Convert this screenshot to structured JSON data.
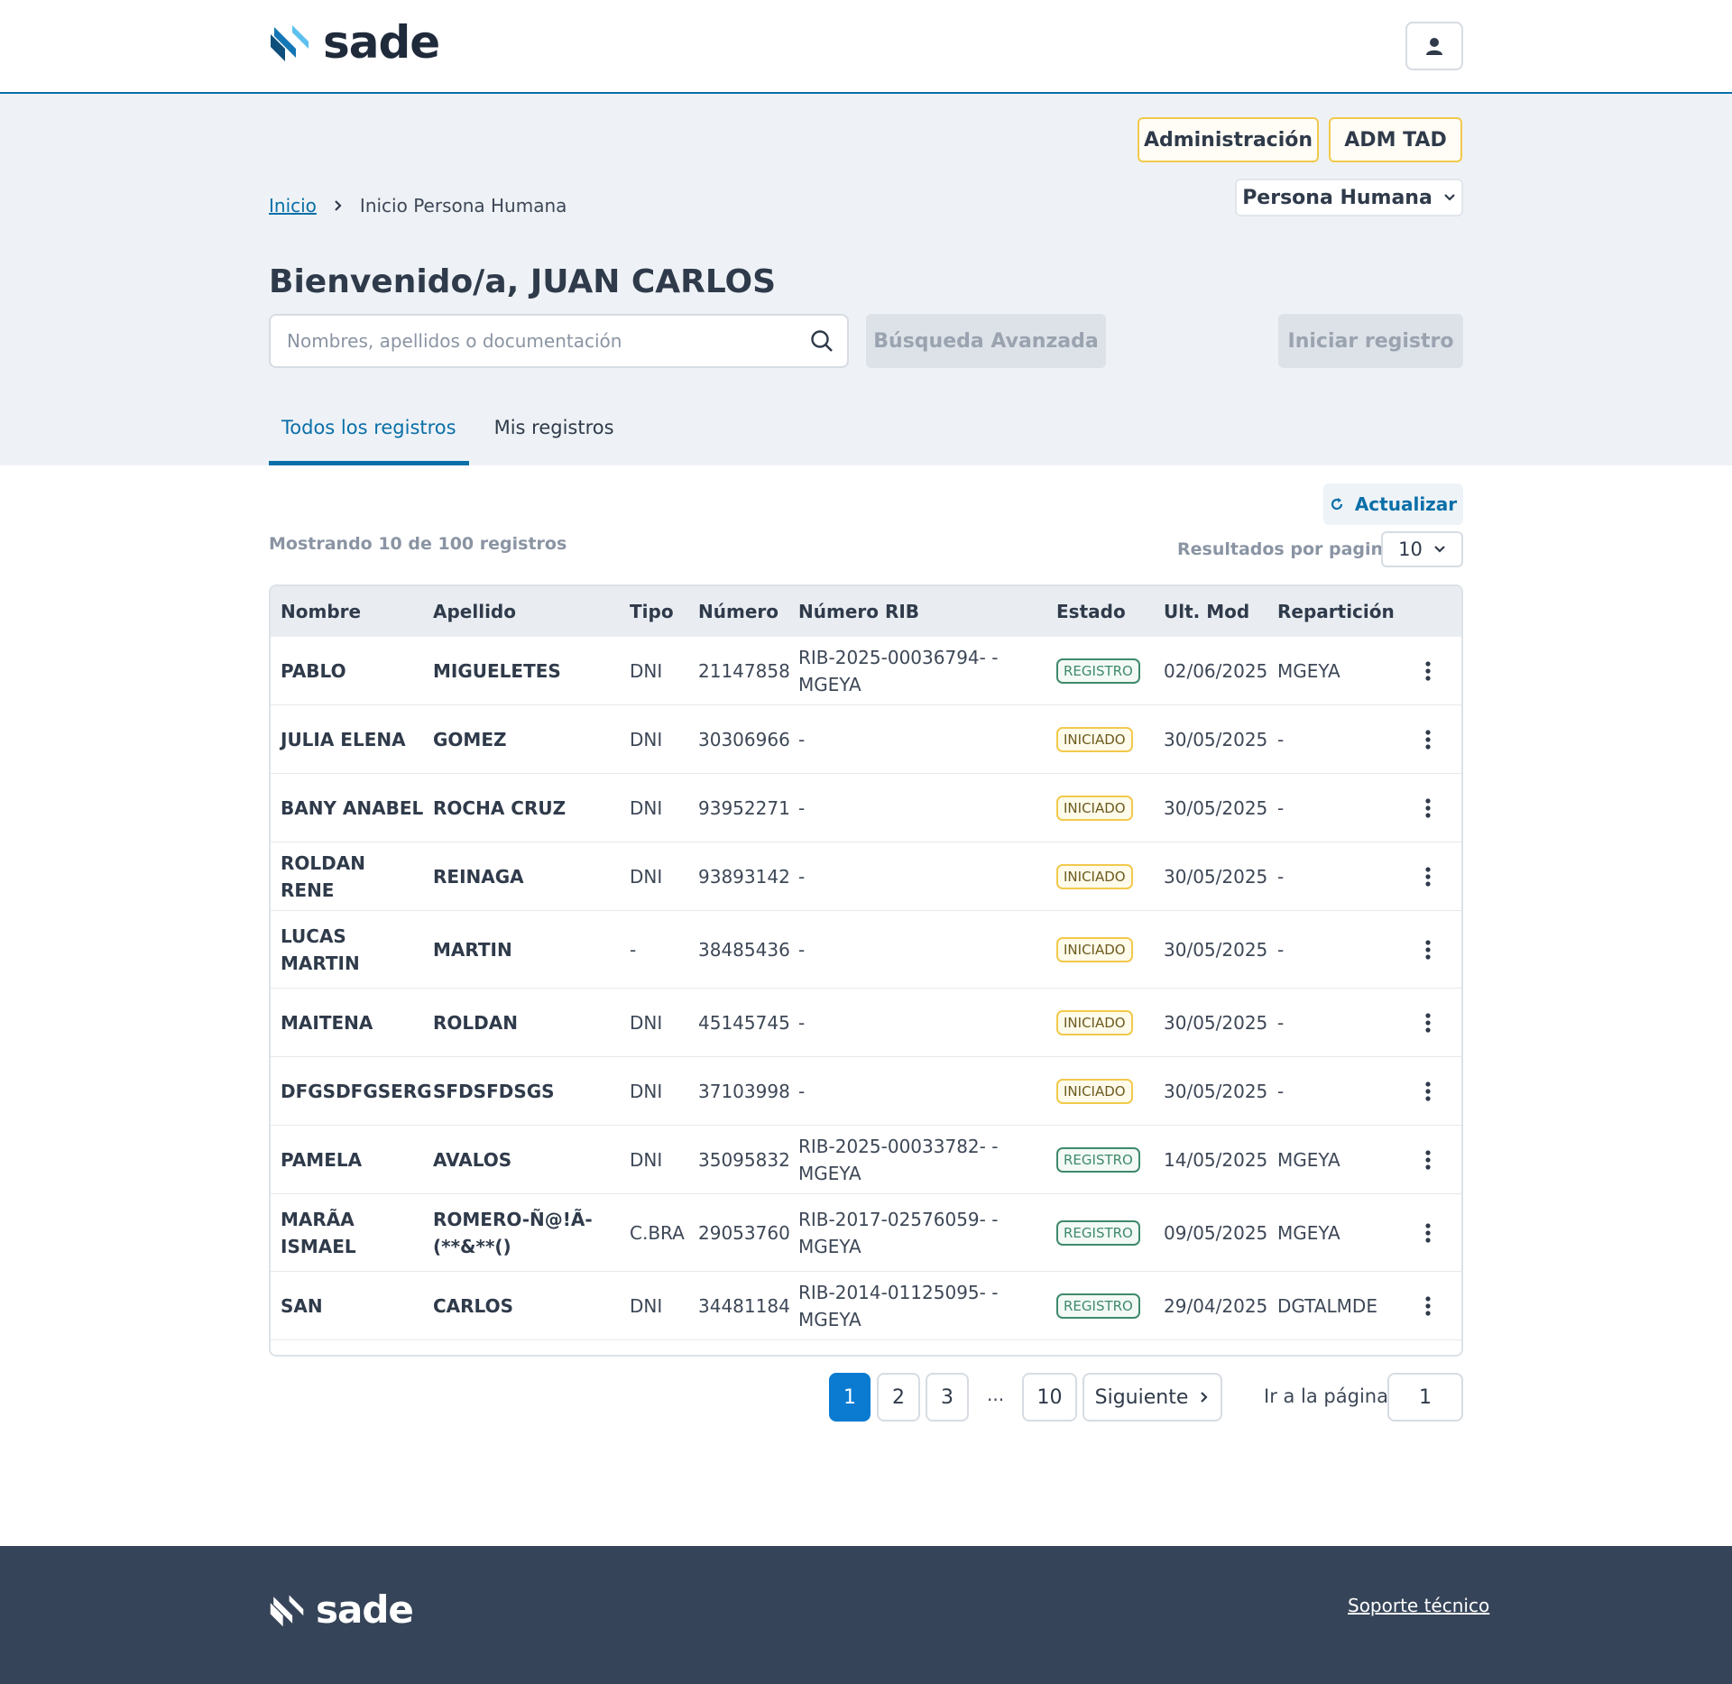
{
  "header": {
    "logo_text": "sade",
    "user_icon": "user-icon"
  },
  "hero": {
    "admin_button": "Administración",
    "admtad_button": "ADM TAD",
    "persona_select": "Persona Humana",
    "breadcrumb": {
      "home": "Inicio",
      "current": "Inicio Persona Humana"
    },
    "welcome": "Bienvenido/a, JUAN CARLOS",
    "search_placeholder": "Nombres, apellidos o documentación",
    "advanced_search": "Búsqueda Avanzada",
    "start_registration": "Iniciar registro",
    "tabs": [
      {
        "label": "Todos los registros",
        "active": true
      },
      {
        "label": "Mis registros",
        "active": false
      }
    ]
  },
  "toolbar": {
    "refresh": "Actualizar",
    "count_text": "Mostrando 10 de 100 registros",
    "per_page_label": "Resultados por pagina",
    "per_page_value": "10"
  },
  "table": {
    "columns": [
      "Nombre",
      "Apellido",
      "Tipo",
      "Número",
      "Número RIB",
      "Estado",
      "Ult. Mod",
      "Repartición"
    ],
    "rows": [
      {
        "nombre": "PABLO",
        "apellido": "MIGUELETES",
        "tipo": "DNI",
        "numero": "21147858",
        "rib": "RIB-2025-00036794- -MGEYA",
        "estado": "REGISTRO",
        "mod": "02/06/2025",
        "reparticion": "MGEYA"
      },
      {
        "nombre": "JULIA ELENA",
        "apellido": "GOMEZ",
        "tipo": "DNI",
        "numero": "30306966",
        "rib": "-",
        "estado": "INICIADO",
        "mod": "30/05/2025",
        "reparticion": "-"
      },
      {
        "nombre": "BANY ANABEL",
        "apellido": "ROCHA CRUZ",
        "tipo": "DNI",
        "numero": "93952271",
        "rib": "-",
        "estado": "INICIADO",
        "mod": "30/05/2025",
        "reparticion": "-"
      },
      {
        "nombre": "ROLDAN RENE",
        "apellido": "REINAGA",
        "tipo": "DNI",
        "numero": "93893142",
        "rib": "-",
        "estado": "INICIADO",
        "mod": "30/05/2025",
        "reparticion": "-"
      },
      {
        "nombre": "LUCAS MARTIN",
        "apellido": "MARTIN",
        "tipo": "-",
        "numero": "38485436",
        "rib": "-",
        "estado": "INICIADO",
        "mod": "30/05/2025",
        "reparticion": "-"
      },
      {
        "nombre": "MAITENA",
        "apellido": "ROLDAN",
        "tipo": "DNI",
        "numero": "45145745",
        "rib": "-",
        "estado": "INICIADO",
        "mod": "30/05/2025",
        "reparticion": "-"
      },
      {
        "nombre": "DFGSDFGSERG",
        "apellido": "SFDSFDSGS",
        "tipo": "DNI",
        "numero": "37103998",
        "rib": "-",
        "estado": "INICIADO",
        "mod": "30/05/2025",
        "reparticion": "-"
      },
      {
        "nombre": "PAMELA",
        "apellido": "AVALOS",
        "tipo": "DNI",
        "numero": "35095832",
        "rib": "RIB-2025-00033782- -MGEYA",
        "estado": "REGISTRO",
        "mod": "14/05/2025",
        "reparticion": "MGEYA"
      },
      {
        "nombre": "MARÃA ISMAEL",
        "apellido": "ROMERO-Ñ@!Ã-(**&**()",
        "tipo": "C.BRA",
        "numero": "29053760",
        "rib": "RIB-2017-02576059- -MGEYA",
        "estado": "REGISTRO",
        "mod": "09/05/2025",
        "reparticion": "MGEYA"
      },
      {
        "nombre": "SAN",
        "apellido": "CARLOS",
        "tipo": "DNI",
        "numero": "34481184",
        "rib": "RIB-2014-01125095- -MGEYA",
        "estado": "REGISTRO",
        "mod": "29/04/2025",
        "reparticion": "DGTALMDE"
      }
    ]
  },
  "pagination": {
    "pages": [
      "1",
      "2",
      "3"
    ],
    "ellipsis": "...",
    "last": "10",
    "next": "Siguiente",
    "goto_label": "Ir a la página",
    "goto_value": "1"
  },
  "footer": {
    "logo_text": "sade",
    "support": "Soporte técnico"
  },
  "colors": {
    "primary": "#0a6fa8",
    "accent_yellow": "#f2c94c",
    "registro_green": "#3f8a6b",
    "footer_bg": "#364459"
  }
}
